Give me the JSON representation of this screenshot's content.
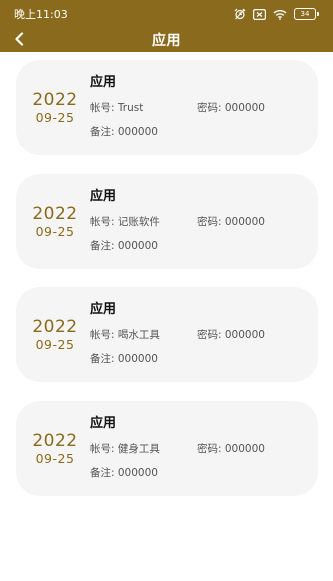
{
  "status_bar": {
    "time": "晚上11:03",
    "battery": "34"
  },
  "app_bar": {
    "title": "应用"
  },
  "cards": [
    {
      "year": "2022",
      "day": "09-25",
      "title": "应用",
      "account": "帐号: Trust",
      "password": "密码: 000000",
      "note": "备注: 000000"
    },
    {
      "year": "2022",
      "day": "09-25",
      "title": "应用",
      "account": "帐号: 记账软件",
      "password": "密码: 000000",
      "note": "备注: 000000"
    },
    {
      "year": "2022",
      "day": "09-25",
      "title": "应用",
      "account": "帐号: 喝水工具",
      "password": "密码: 000000",
      "note": "备注: 000000"
    },
    {
      "year": "2022",
      "day": "09-25",
      "title": "应用",
      "account": "帐号: 健身工具",
      "password": "密码: 000000",
      "note": "备注: 000000"
    }
  ],
  "colors": {
    "accent": "#8a6a1c",
    "card_background": "#f5f5f5"
  },
  "icons": {
    "back": "chevron-left-icon",
    "status": [
      "alarm-icon",
      "sim-icon",
      "wifi-icon",
      "battery-icon"
    ]
  }
}
